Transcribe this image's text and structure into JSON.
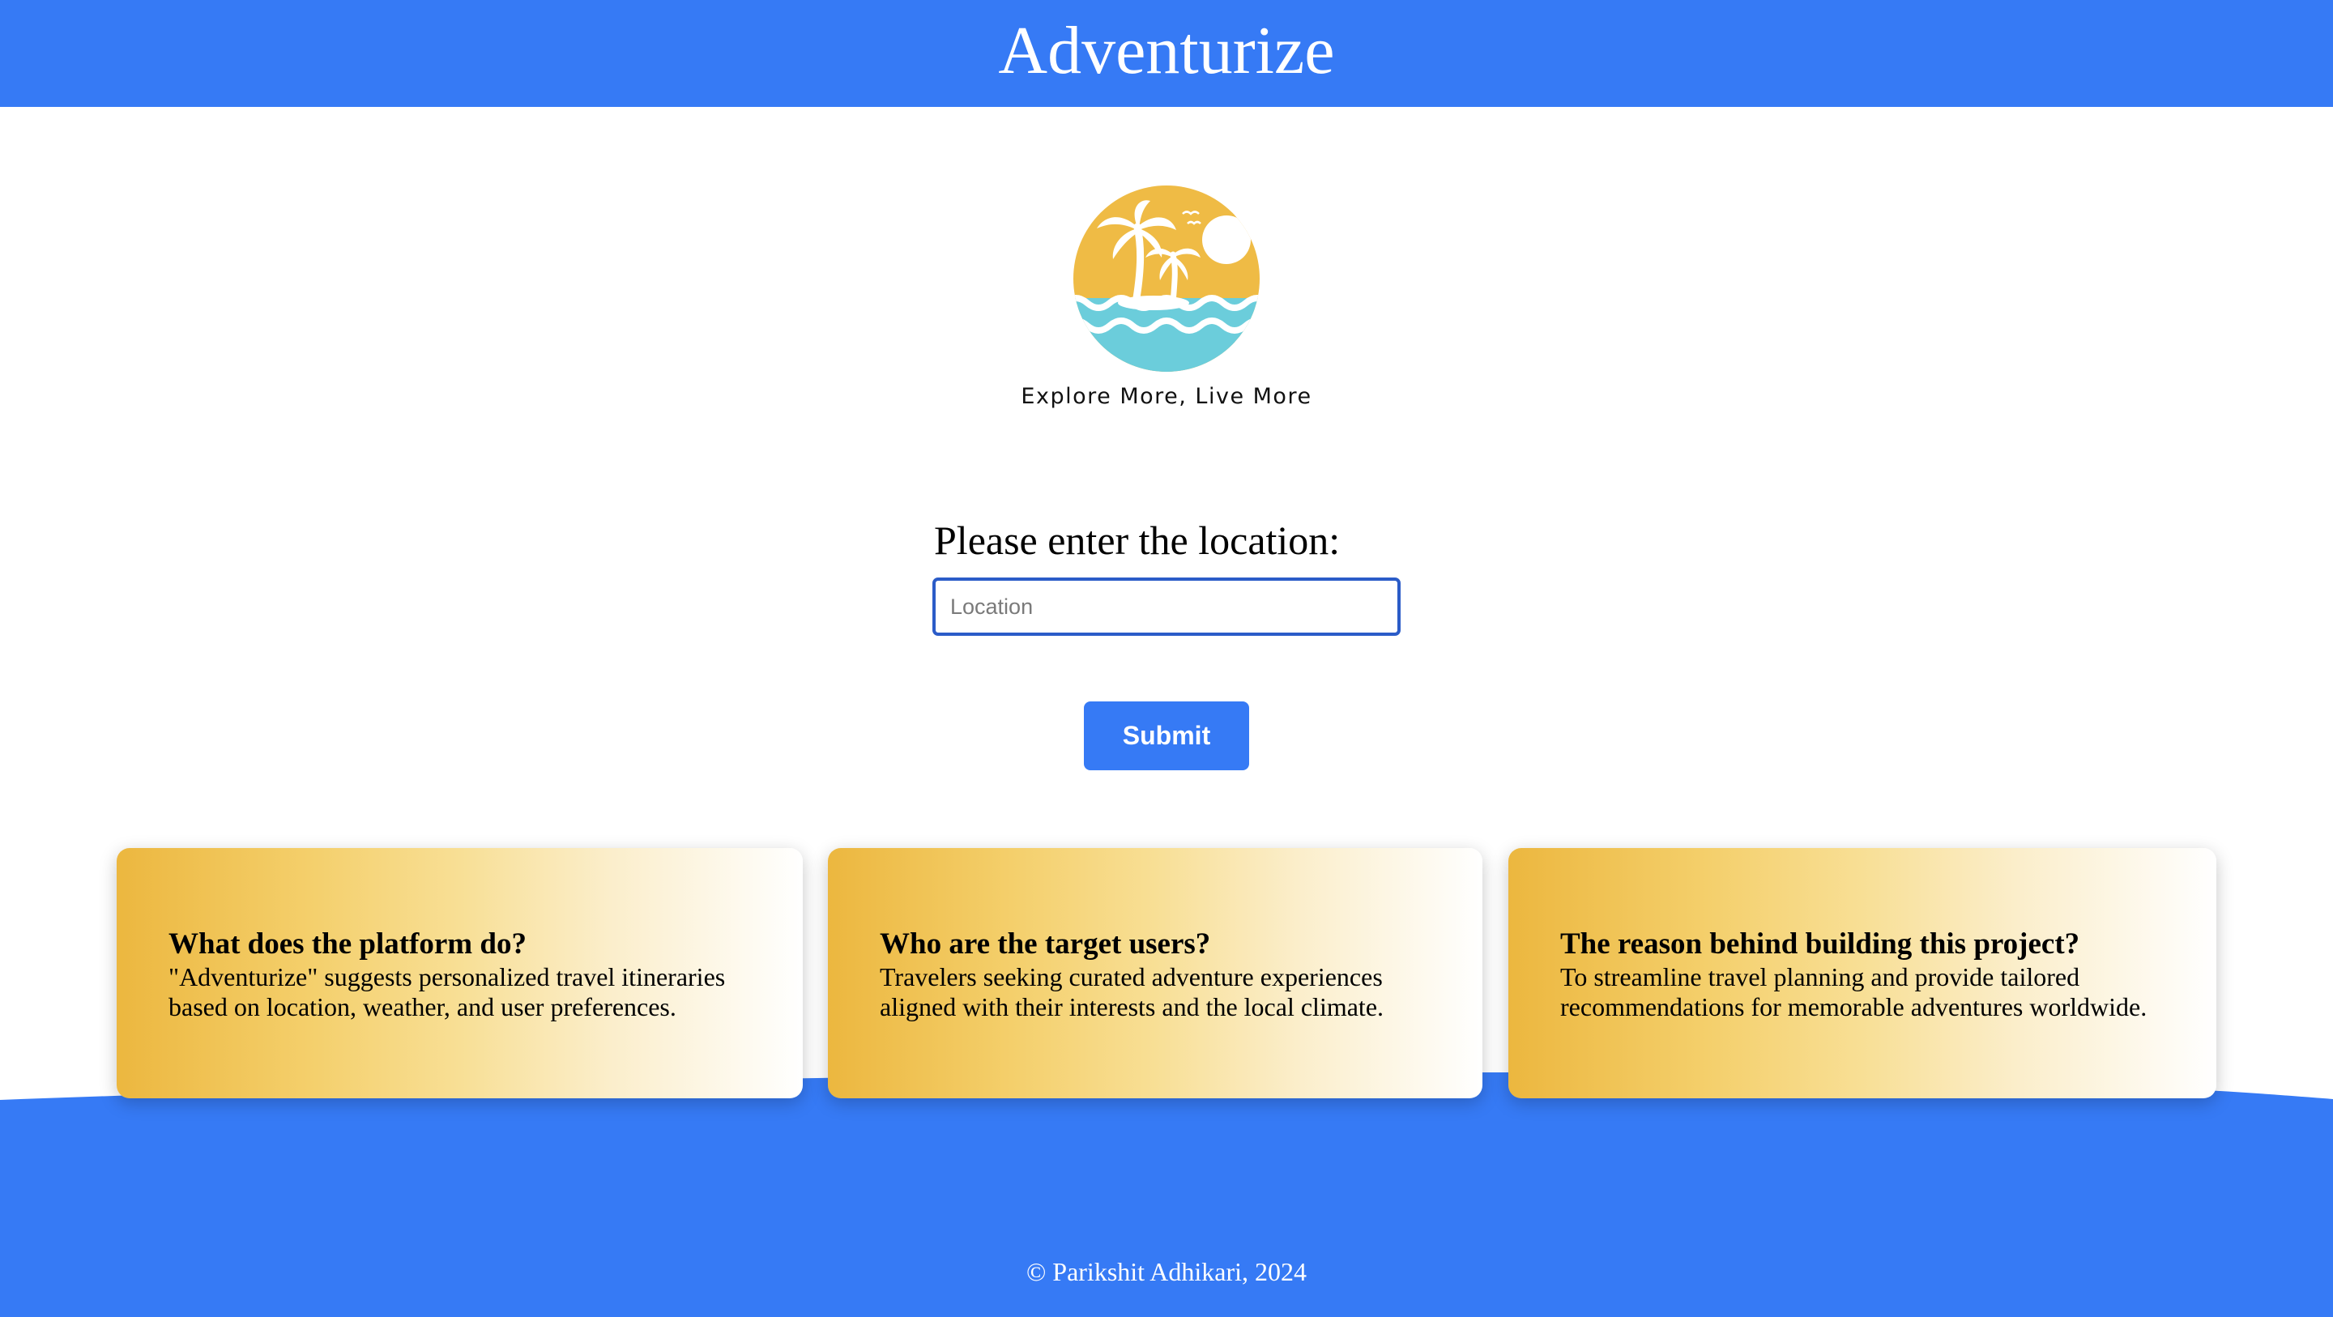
{
  "header": {
    "title": "Adventurize"
  },
  "logo": {
    "tagline": "Explore More, Live More",
    "colors": {
      "sun_disc": "#efbb45",
      "sea": "#6bcddb",
      "silhouette": "#ffffff"
    }
  },
  "form": {
    "label": "Please enter the location:",
    "location_placeholder": "Location",
    "location_value": "",
    "submit_label": "Submit"
  },
  "cards": [
    {
      "title": "What does the platform do?",
      "text": "\"Adventurize\" suggests personalized travel itineraries based on location, weather, and user preferences."
    },
    {
      "title": "Who are the target users?",
      "text": "Travelers seeking curated adventure experiences aligned with their interests and the local climate."
    },
    {
      "title": "The reason behind building this project?",
      "text": "To streamline travel planning and provide tailored recommendations for memorable adventures worldwide."
    }
  ],
  "footer": {
    "copyright": "© Parikshit Adhikari, 2024"
  },
  "colors": {
    "brand_blue": "#367af5",
    "input_border": "#2b5cc8",
    "card_gradient_start": "#ecb73f",
    "card_gradient_end": "#ffffff"
  }
}
